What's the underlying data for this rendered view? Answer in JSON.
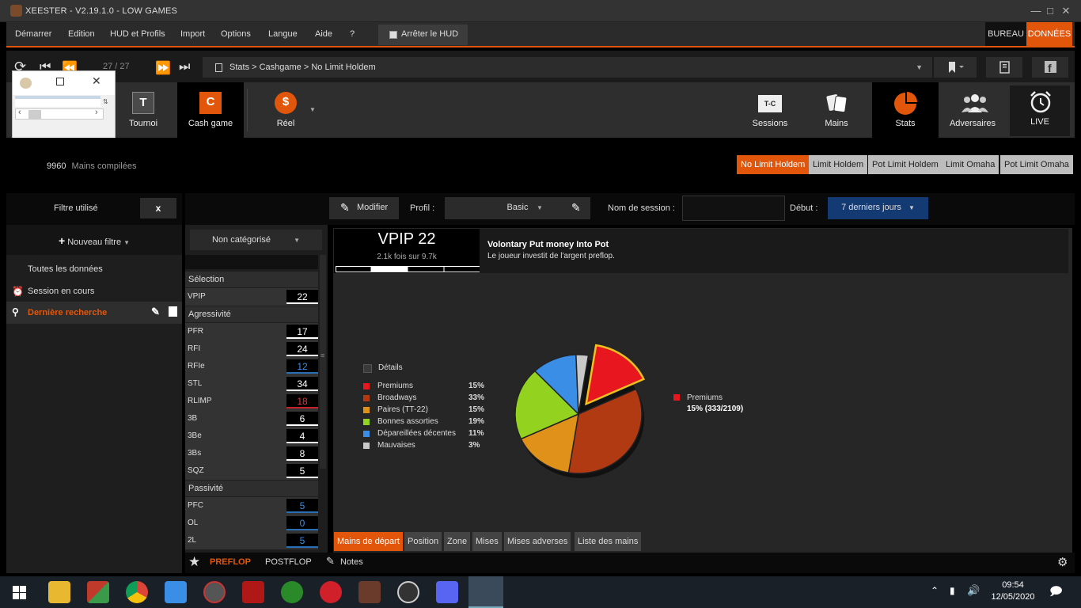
{
  "window": {
    "title": "XEESTER - V2.19.1.0 - LOW GAMES"
  },
  "menu": {
    "items": [
      "Démarrer",
      "Edition",
      "HUD et Profils",
      "Import",
      "Options",
      "Langue",
      "Aide",
      "?"
    ],
    "hud_toggle": "Arrêter le HUD",
    "bureau": "BUREAU",
    "donnees": "DONNÉES"
  },
  "nav": {
    "page_count": "27 / 27",
    "breadcrumb": "Stats > Cashgame > No Limit Holdem"
  },
  "tabs": {
    "tournoi": "Tournoi",
    "cashgame": "Cash game",
    "reel": "Réel",
    "sessions": "Sessions",
    "sessions_icon_text": "T-C",
    "mains": "Mains",
    "stats": "Stats",
    "adversaires": "Adversaires",
    "live": "LIVE",
    "tournoi_letter": "T",
    "cashgame_letter": "C"
  },
  "info": {
    "hands_count": "9960",
    "hands_label": "Mains compilées",
    "games": [
      "No Limit Holdem",
      "Limit Holdem",
      "Pot Limit Holdem",
      "Limit Omaha",
      "Pot Limit Omaha"
    ]
  },
  "sidebar": {
    "filter_label": "Filtre utilisé",
    "filter_clear": "x",
    "new_filter": "Nouveau filtre",
    "items": [
      "Toutes les données",
      "Session en cours",
      "Dernière recherche"
    ]
  },
  "toolbar": {
    "modifier": "Modifier",
    "profil_label": "Profil :",
    "profil_value": "Basic",
    "session_label": "Nom de session :",
    "debut_label": "Début :",
    "debut_value": "7 derniers jours"
  },
  "stats": {
    "category": "Non catégorisé",
    "sections": {
      "selection": "Sélection",
      "agressivite": "Agressivité",
      "passivite": "Passivité"
    },
    "selection_rows": [
      {
        "name": "VPIP",
        "value": "22"
      }
    ],
    "aggr_rows": [
      {
        "name": "PFR",
        "value": "17"
      },
      {
        "name": "RFI",
        "value": "24"
      },
      {
        "name": "RFIe",
        "value": "12"
      },
      {
        "name": "STL",
        "value": "34"
      },
      {
        "name": "RLIMP",
        "value": "18"
      },
      {
        "name": "3B",
        "value": "6"
      },
      {
        "name": "3Be",
        "value": "4"
      },
      {
        "name": "3Bs",
        "value": "8"
      },
      {
        "name": "SQZ",
        "value": "5"
      }
    ],
    "pass_rows": [
      {
        "name": "PFC",
        "value": "5"
      },
      {
        "name": "OL",
        "value": "0"
      },
      {
        "name": "2L",
        "value": "5"
      }
    ]
  },
  "detail": {
    "stat_title": "VPIP 22",
    "stat_sub": "2.1k fois sur 9.7k",
    "desc_title": "Volontary Put money Into Pot",
    "desc_text": "Le joueur investit de l'argent preflop.",
    "details_label": "Détails",
    "highlight_name": "Premiums",
    "highlight_value": "15% (333/2109)"
  },
  "chart_data": {
    "type": "pie",
    "slices": [
      {
        "label": "Premiums",
        "value": 15,
        "color": "#e8161e"
      },
      {
        "label": "Broadways",
        "value": 33,
        "color": "#b23a12"
      },
      {
        "label": "Paires (TT-22)",
        "value": 15,
        "color": "#e0911a"
      },
      {
        "label": "Bonnes assorties",
        "value": 19,
        "color": "#93d21f"
      },
      {
        "label": "Dépareillées décentes",
        "value": 11,
        "color": "#3a8ee6"
      },
      {
        "label": "Mauvaises",
        "value": 3,
        "color": "#c8c8c8"
      }
    ],
    "exploded": "Premiums"
  },
  "bottom_tabs": [
    "Mains de départ",
    "Position",
    "Zone",
    "Mises",
    "Mises adverses",
    "Liste des mains"
  ],
  "street_bar": {
    "preflop": "PREFLOP",
    "postflop": "POSTFLOP",
    "notes": "Notes"
  },
  "taskbar": {
    "time": "09:54",
    "date": "12/05/2020"
  },
  "colors": {
    "accent": "#e2560b",
    "blue": "#3a8ee6",
    "red": "#e8343a"
  }
}
